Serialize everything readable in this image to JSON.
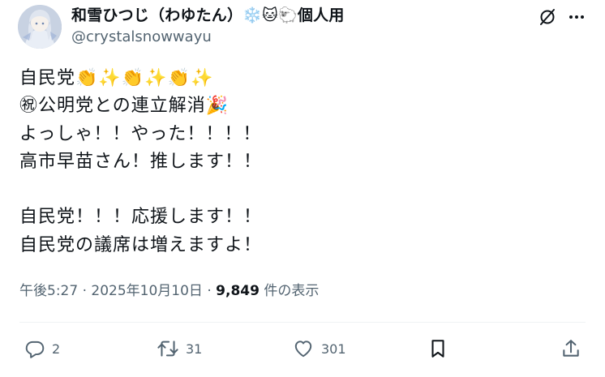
{
  "author": {
    "display_name": "和雪ひつじ（わゆたん）❄️🐱🐑個人用",
    "handle": "@crystalsnowwayu"
  },
  "icons": {
    "header": [
      "grok-icon",
      "more-icon"
    ],
    "actions": [
      "reply-icon",
      "retweet-icon",
      "like-icon",
      "bookmark-icon",
      "share-icon"
    ]
  },
  "post": {
    "lines": [
      "自民党👏✨👏✨👏✨",
      "㊗公明党との連立解消🎉",
      "よっしゃ！！やった！！！！",
      "高市早苗さん！推します！！",
      "",
      "自民党！！！応援します！！",
      "自民党の議席は増えますよ！"
    ]
  },
  "meta": {
    "time": "午後5:27",
    "separator": "·",
    "date": "2025年10月10日",
    "views_count": "9,849",
    "views_label": "件の表示"
  },
  "stats": {
    "replies": "2",
    "retweets": "31",
    "likes": "301"
  },
  "colors": {
    "text_primary": "#0f1419",
    "text_secondary": "#536471",
    "divider": "#eff3f4"
  }
}
